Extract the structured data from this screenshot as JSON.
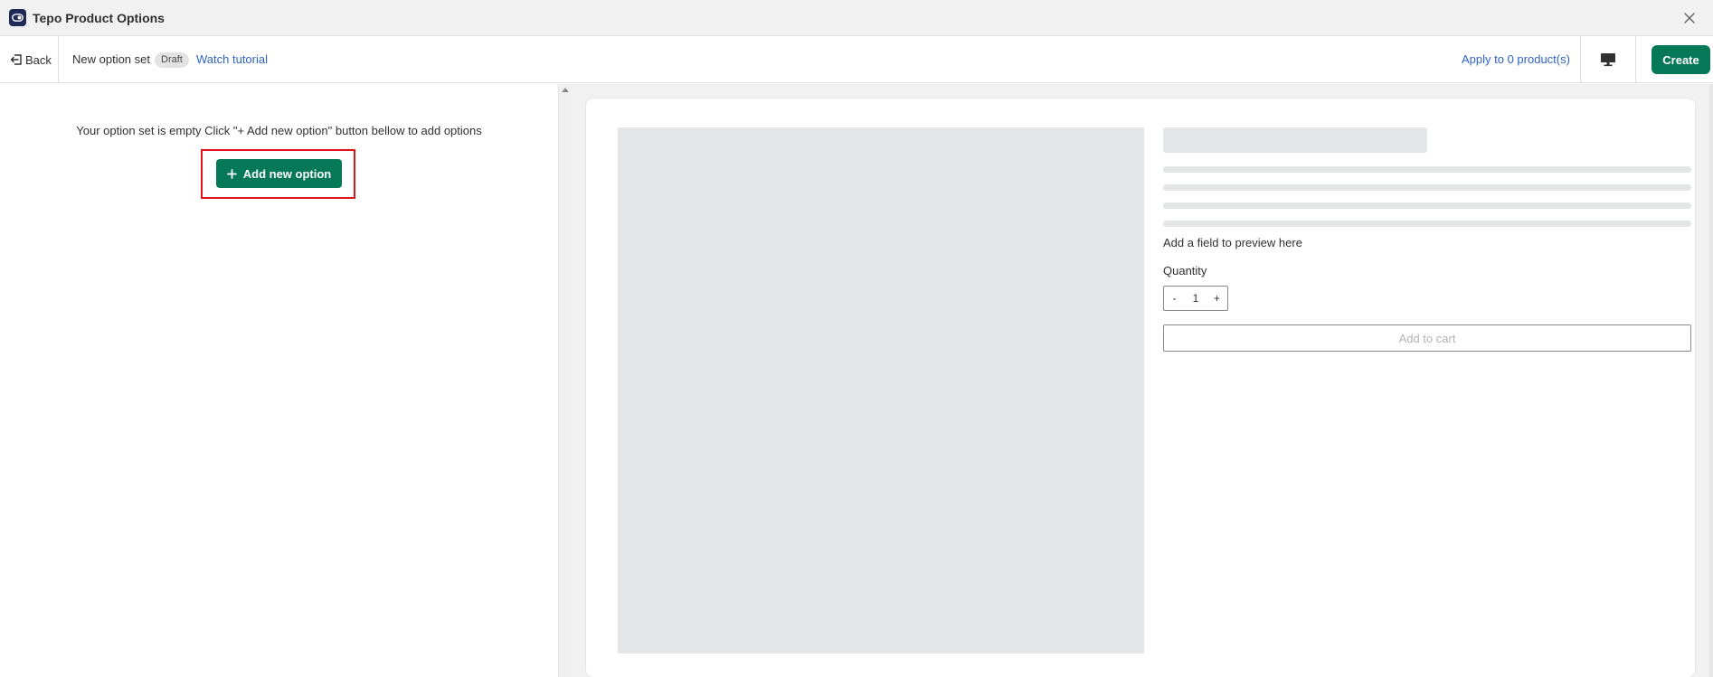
{
  "window": {
    "title": "Tepo Product Options",
    "close_icon": "close-icon"
  },
  "toolbar": {
    "back_label": "Back",
    "set_name": "New option set",
    "status_badge": "Draft",
    "watch_tutorial": "Watch tutorial",
    "apply_products": "Apply to 0 product(s)",
    "device_icon": "desktop-monitor-icon",
    "create_label": "Create"
  },
  "editor": {
    "empty_message": "Your option set is empty Click \"+ Add new option\" button bellow to add options",
    "add_option_label": "Add new option"
  },
  "preview": {
    "hint": "Add a field to preview here",
    "quantity_label": "Quantity",
    "quantity_minus": "-",
    "quantity_value": "1",
    "quantity_plus": "+",
    "add_to_cart": "Add to cart"
  },
  "colors": {
    "primary_green": "#047857",
    "link_blue": "#2f63c8",
    "highlight_red": "#e0141b",
    "skeleton_gray": "#e4e5e7"
  }
}
